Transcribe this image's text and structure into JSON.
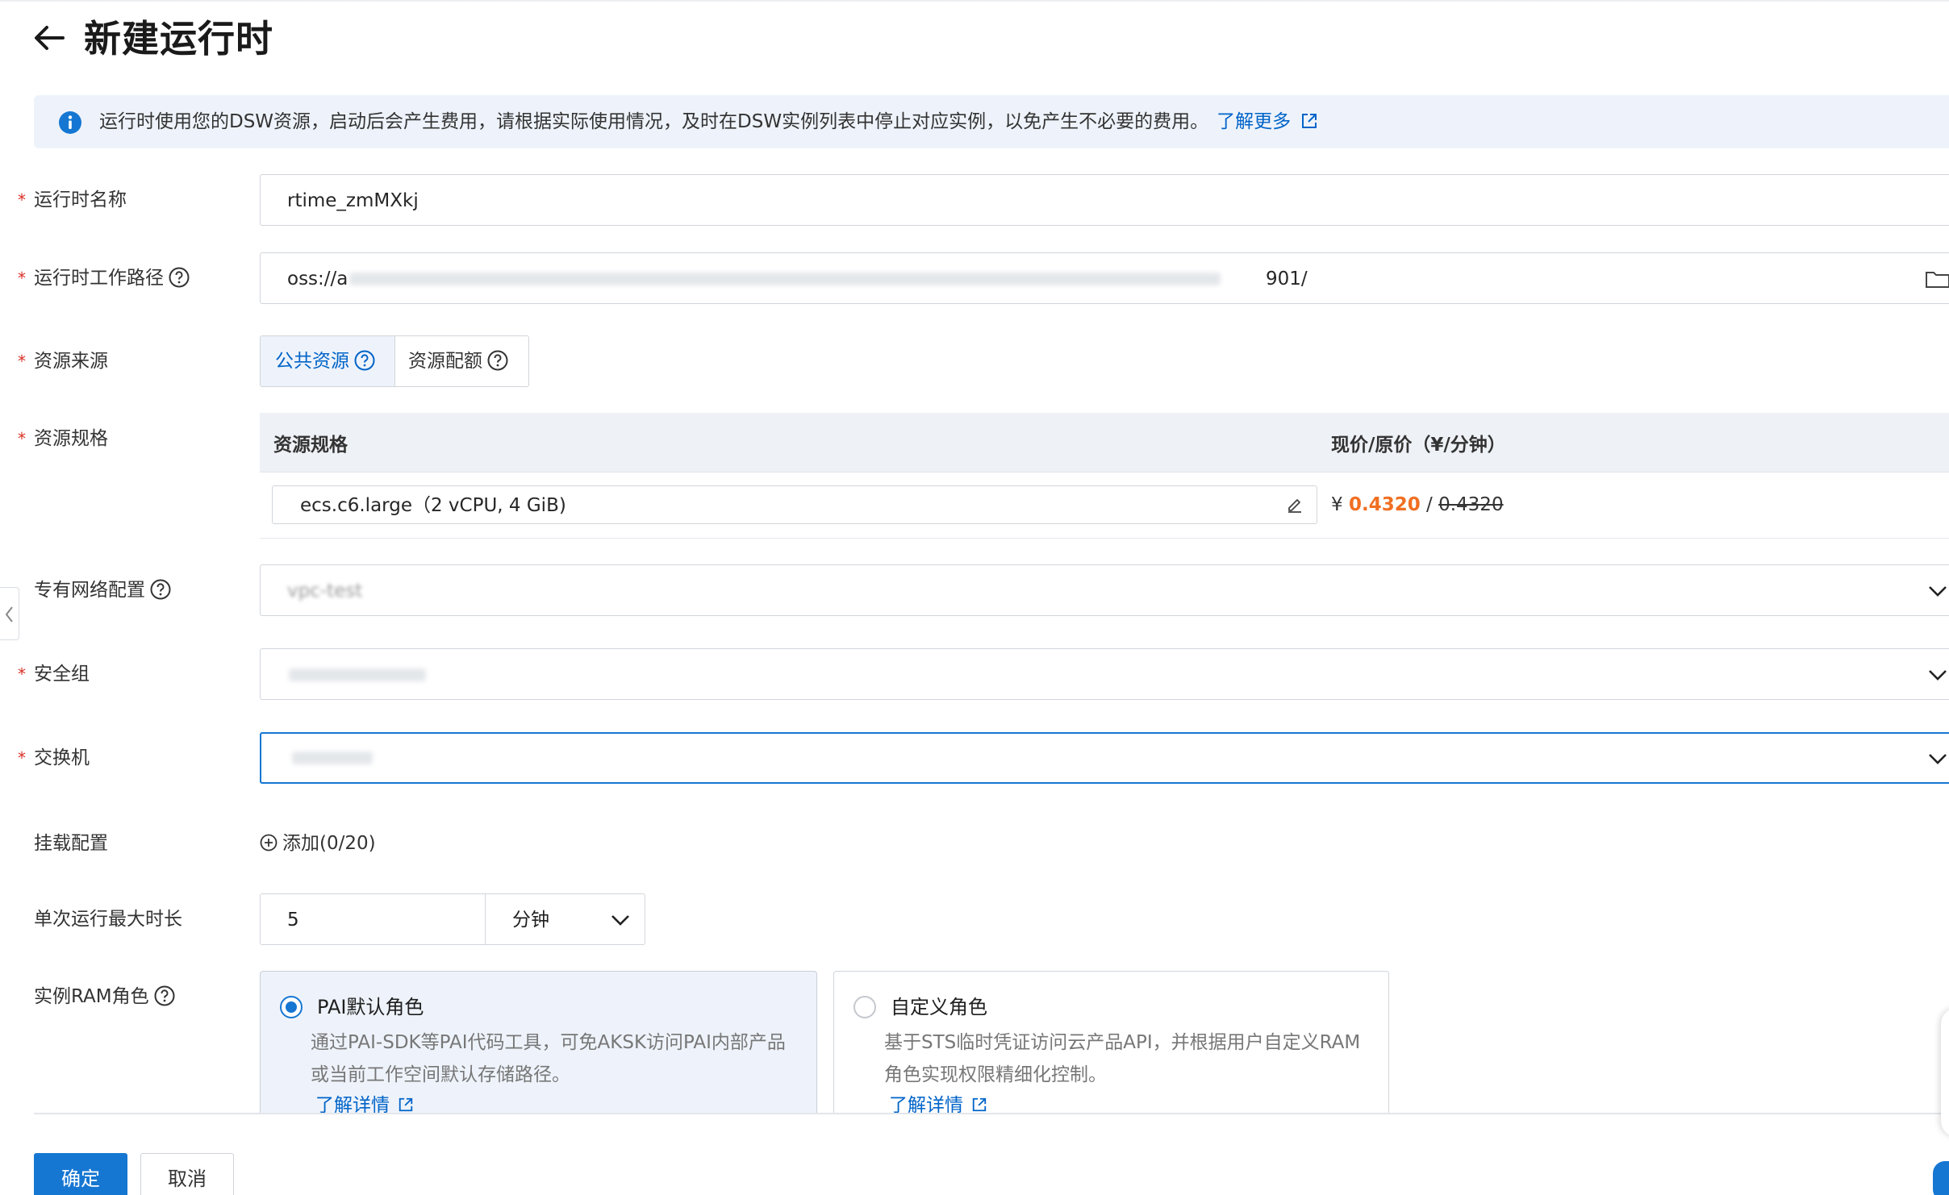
{
  "header": {
    "title": "新建运行时"
  },
  "notice": {
    "text": "运行时使用您的DSW资源，启动后会产生费用，请根据实际使用情况，及时在DSW实例列表中停止对应实例，以免产生不必要的费用。",
    "link": "了解更多"
  },
  "form": {
    "name": {
      "label": "运行时名称",
      "value": "rtime_zmMXkj"
    },
    "path": {
      "label": "运行时工作路径",
      "value_prefix": "oss://a",
      "value_suffix": "901/"
    },
    "source": {
      "label": "资源来源",
      "options": [
        "公共资源",
        "资源配额"
      ],
      "selected": "公共资源"
    },
    "spec": {
      "label": "资源规格",
      "col_spec": "资源规格",
      "col_price": "现价/原价（¥/分钟）",
      "value": "ecs.c6.large（2 vCPU, 4 GiB)",
      "currency": "¥",
      "price_now": "0.4320",
      "price_sep": "/",
      "price_orig": "0.4320"
    },
    "vpc": {
      "label": "专有网络配置",
      "value": "vpc-test"
    },
    "security_group": {
      "label": "安全组"
    },
    "switch": {
      "label": "交换机"
    },
    "mount": {
      "label": "挂载配置",
      "add": "添加(0/20)"
    },
    "duration": {
      "label": "单次运行最大时长",
      "value": "5",
      "unit": "分钟"
    },
    "ram_role": {
      "label": "实例RAM角色",
      "options": [
        {
          "title": "PAI默认角色",
          "desc": "通过PAI-SDK等PAI代码工具，可免AKSK访问PAI内部产品或当前工作空间默认存储路径。",
          "link": "了解详情",
          "selected": true
        },
        {
          "title": "自定义角色",
          "desc": "基于STS临时凭证访问云产品API，并根据用户自定义RAM角色实现权限精细化控制。",
          "link": "了解详情",
          "selected": false
        }
      ]
    }
  },
  "footer": {
    "confirm": "确定",
    "cancel": "取消"
  },
  "colors": {
    "primary": "#1677d2",
    "link": "#0064c8",
    "price": "#f06f22",
    "required": "#d93026",
    "notice_bg": "#eef3fb"
  }
}
